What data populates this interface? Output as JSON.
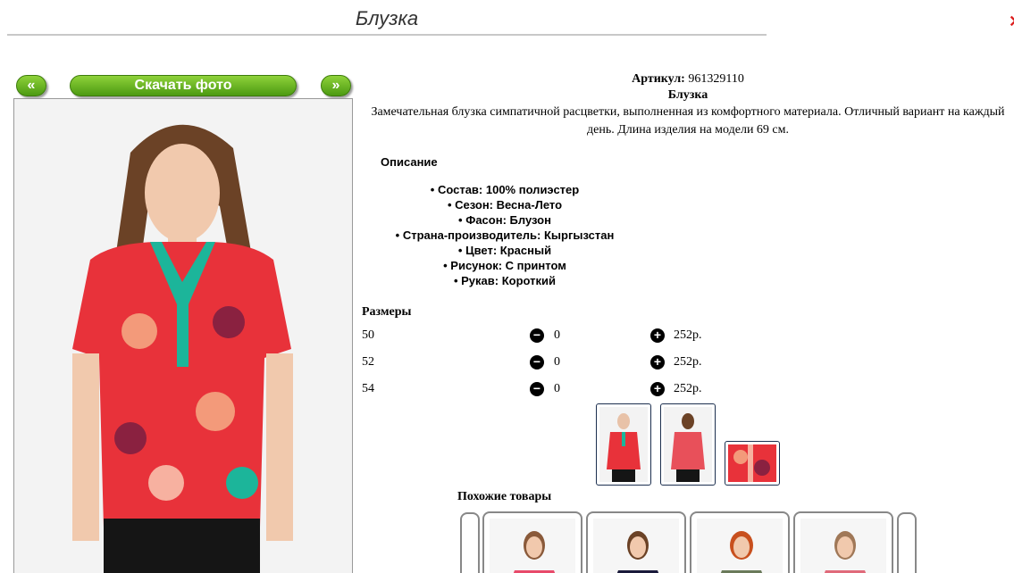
{
  "page": {
    "title": "Блузка"
  },
  "gallery": {
    "prev_label": "«",
    "next_label": "»",
    "download_label": "Скачать фото"
  },
  "product": {
    "article_label": "Артикул:",
    "article": "961329110",
    "name": "Блузка",
    "description": "Замечательная блузка симпатичной расцветки, выполненная из комфортного материала. Отличный вариант на каждый день. Длина изделия на модели 69 см."
  },
  "details": {
    "heading": "Описание",
    "items": [
      "Состав: 100% полиэстер",
      "Сезон: Весна-Лето",
      "Фасон: Блузон",
      "Страна-производитель: Кыргызстан",
      "Цвет: Красный",
      "Рисунок: С принтом",
      "Рукав: Короткий"
    ]
  },
  "sizes": {
    "heading": "Размеры",
    "rows": [
      {
        "size": "50",
        "qty": "0",
        "price": "252р."
      },
      {
        "size": "52",
        "qty": "0",
        "price": "252р."
      },
      {
        "size": "54",
        "qty": "0",
        "price": "252р."
      }
    ],
    "minus_icon": "−",
    "plus_icon": "+"
  },
  "similar": {
    "heading": "Похожие товары"
  },
  "colors": {
    "button_green": "#5aa817",
    "blouse_red": "#e8323a",
    "collar_teal": "#1cb59a"
  }
}
